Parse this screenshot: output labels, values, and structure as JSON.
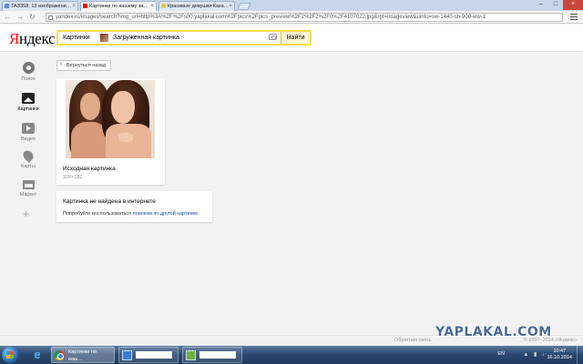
{
  "browser": {
    "tabs": [
      {
        "label": "ТАЗ358: 13 изображени…"
      },
      {
        "label": "Картинки по вашему за…"
      },
      {
        "label": "Красивые девушки Каза…"
      }
    ],
    "url": "yandex.ru/images/search?img_url=http%3A%2F%2Fs00.yaplakal.com%2Fpics%2Fpics_preview%2F2%2F2%2F0%2F4107022.jpg&rpt=imageview&uinfo=sw-1440-sh-900-ww-1"
  },
  "header": {
    "logo_first": "Я",
    "logo_rest": "ндекс",
    "search": {
      "service": "Картинки",
      "query": "Загруженная картинка",
      "button": "Найти"
    }
  },
  "sidebar": {
    "items": [
      {
        "label": "Поиск",
        "icon": "search-icon"
      },
      {
        "label": "Картинки",
        "icon": "images-icon"
      },
      {
        "label": "Видео",
        "icon": "video-icon"
      },
      {
        "label": "Карты",
        "icon": "maps-icon"
      },
      {
        "label": "Маркет",
        "icon": "market-icon"
      }
    ],
    "more": "+"
  },
  "main": {
    "back": "Вернуться назад",
    "original": {
      "title": "Исходная картинка",
      "size": "320×282"
    },
    "not_found": {
      "title": "Картинка не найдена в интернете",
      "text_before": "Попробуйте воспользоваться ",
      "link": "поиском по другой картинке",
      "text_after": "."
    }
  },
  "footer": {
    "feedback": "Обратная связь",
    "copyright": "© 1997–2014 «Яндекс»",
    "watermark": "YAPLAKAL.COM"
  },
  "taskbar": {
    "tasks": [
      {
        "label": "Картинки по ваш…"
      }
    ],
    "lang": "EN",
    "time": "10:47",
    "date": "16.10.2014"
  }
}
